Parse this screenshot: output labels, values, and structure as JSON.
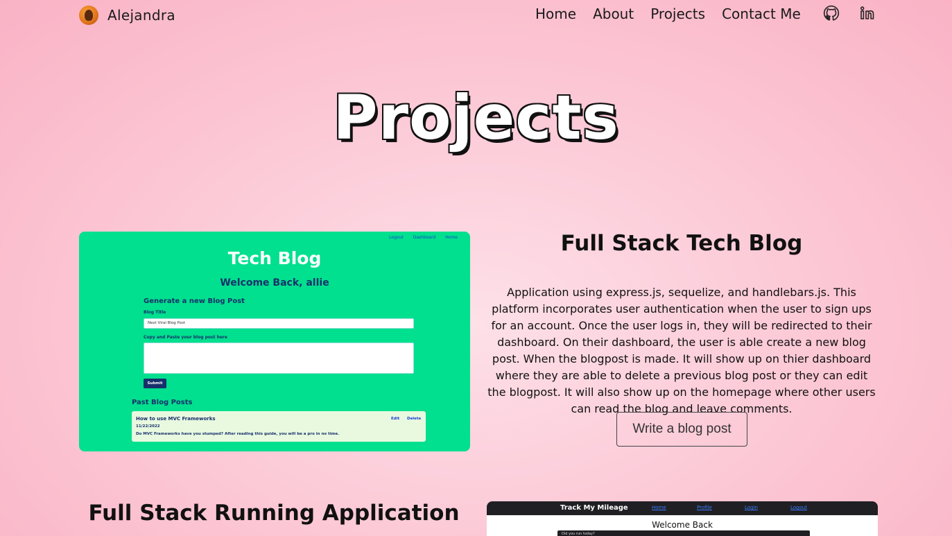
{
  "header": {
    "brand_name": "Alejandra",
    "nav": [
      "Home",
      "About",
      "Projects",
      "Contact Me"
    ],
    "icons": [
      "github-icon",
      "linkedin-icon"
    ]
  },
  "page_title": "Projects",
  "projects": [
    {
      "title": "Full Stack Tech Blog",
      "description": "Application using express.js, sequelize, and handlebars.js. This platform incorporates user authentication when the user to sign ups for an account. Once the user logs in, they will be redirected to their dashboard. On their dashboard, the user is able create a new blog post. When the blogpost is made. It will show up on thier dashboard where they are able to delete a previous blog post or they can edit the blogpost. It will also show up on the homepage where other users can read the blog and leave comments.",
      "button": "Write a blog post",
      "screenshot": {
        "nav": [
          "Logout",
          "Dashboard",
          "Home"
        ],
        "app_title": "Tech Blog",
        "welcome": "Welcome Back, allie",
        "generate_heading": "Generate a new Blog Post",
        "title_label": "Blog Title",
        "title_placeholder": "Next Viral Blog Post",
        "body_label": "Copy and Paste your blog post here",
        "submit": "Submit",
        "past_heading": "Past Blog Posts",
        "post": {
          "title": "How to use MVC Frameworks",
          "date": "11/22/2022",
          "body": "Do MVC Frameworks have you stumped? After reading this guide, you will be a pro in no time.",
          "edit": "Edit",
          "delete": "Delete"
        }
      }
    },
    {
      "title": "Full Stack Running Application",
      "screenshot": {
        "app_title": "Track My Mileage",
        "nav": [
          "Home",
          "Profile",
          "Login",
          "Logout"
        ],
        "welcome": "Welcome Back",
        "input_text": "Did you run today?"
      }
    }
  ],
  "colors": {
    "background": "#fcc6d4",
    "tech_blog_green": "#00e08e",
    "navy": "#17306b"
  }
}
